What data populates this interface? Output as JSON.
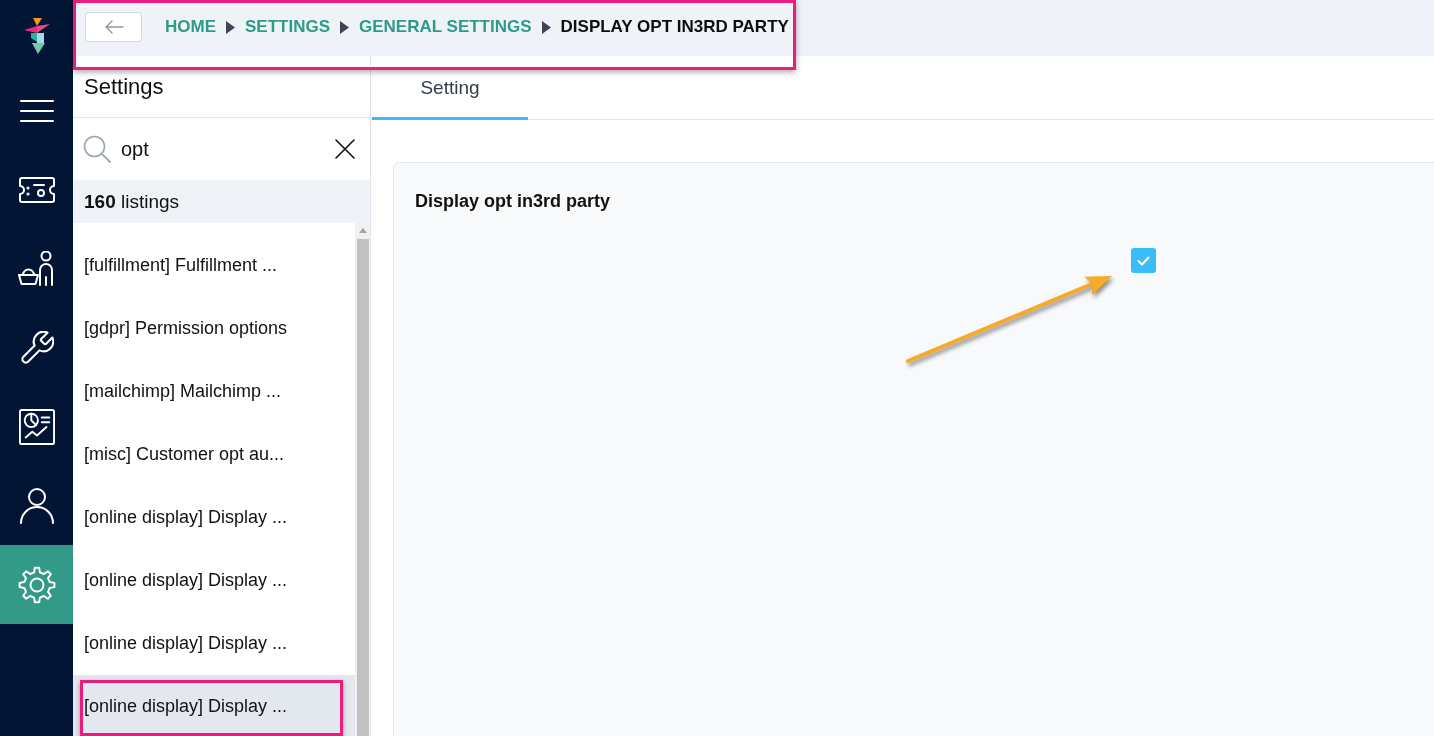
{
  "nav": {
    "items": [
      {
        "selected": false
      },
      {
        "selected": false
      },
      {
        "selected": false
      },
      {
        "selected": false
      },
      {
        "selected": false
      },
      {
        "selected": true
      }
    ]
  },
  "breadcrumb": {
    "highlighted": true,
    "items": [
      {
        "label": "HOME",
        "current": false
      },
      {
        "label": "SETTINGS",
        "current": false
      },
      {
        "label": "GENERAL SETTINGS",
        "current": false
      },
      {
        "label": "DISPLAY OPT IN3RD PARTY",
        "current": true
      }
    ]
  },
  "settings_panel": {
    "title": "Settings",
    "search": {
      "value": "opt"
    },
    "count": "**160** listings",
    "listings": [
      {
        "label": "[fulfillment] Fulfillment ...",
        "selected": false,
        "highlighted": false
      },
      {
        "label": "[gdpr] Permission options",
        "selected": false,
        "highlighted": false
      },
      {
        "label": "[mailchimp] Mailchimp ...",
        "selected": false,
        "highlighted": false
      },
      {
        "label": "[misc] Customer opt au...",
        "selected": false,
        "highlighted": false
      },
      {
        "label": "[online display] Display ...",
        "selected": false,
        "highlighted": false
      },
      {
        "label": "[online display] Display ...",
        "selected": false,
        "highlighted": false
      },
      {
        "label": "[online display] Display ...",
        "selected": false,
        "highlighted": false
      },
      {
        "label": "[online display] Display ...",
        "selected": true,
        "highlighted": true
      }
    ]
  },
  "tabs": [
    {
      "label": "Setting",
      "selected": true
    }
  ],
  "setting": {
    "title": "Display opt in3rd party",
    "checked": true,
    "pointed_by_arrow": true
  }
}
